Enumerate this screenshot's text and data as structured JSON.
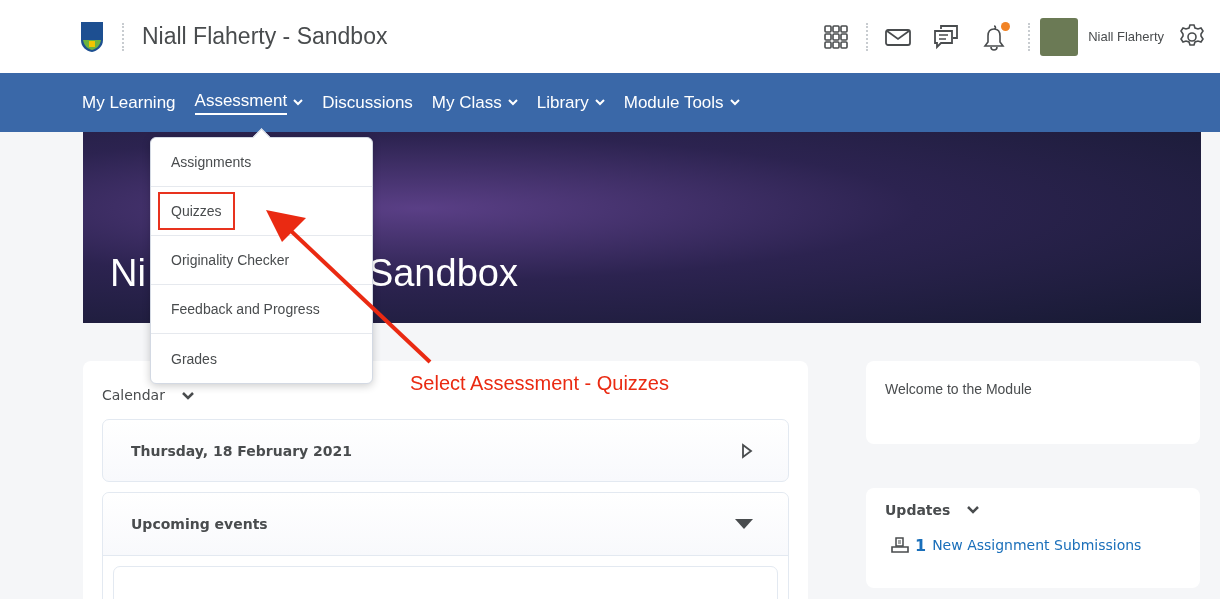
{
  "header": {
    "title": "Niall Flaherty - Sandbox",
    "user_name": "Niall Flaherty",
    "bell_unread": true
  },
  "nav": [
    {
      "label": "My Learning",
      "has_menu": false,
      "selected": false
    },
    {
      "label": "Assessment",
      "has_menu": true,
      "selected": true
    },
    {
      "label": "Discussions",
      "has_menu": false,
      "selected": false
    },
    {
      "label": "My Class",
      "has_menu": true,
      "selected": false
    },
    {
      "label": "Library",
      "has_menu": true,
      "selected": false
    },
    {
      "label": "Module Tools",
      "has_menu": true,
      "selected": false
    }
  ],
  "banner": {
    "title_parts": [
      "Ni",
      "Sandbox"
    ]
  },
  "dropdown": [
    {
      "label": "Assignments",
      "highlighted": false
    },
    {
      "label": "Quizzes",
      "highlighted": true
    },
    {
      "label": "Originality Checker",
      "highlighted": false
    },
    {
      "label": "Feedback and Progress",
      "highlighted": false
    },
    {
      "label": "Grades",
      "highlighted": false
    }
  ],
  "annotation": {
    "text": "Select Assessment - Quizzes"
  },
  "calendar": {
    "title": "Calendar",
    "date": "Thursday, 18 February 2021",
    "upcoming": "Upcoming events"
  },
  "welcome": {
    "text": "Welcome to the Module"
  },
  "updates": {
    "title": "Updates",
    "count": "1",
    "link": "New Assignment Submissions"
  }
}
